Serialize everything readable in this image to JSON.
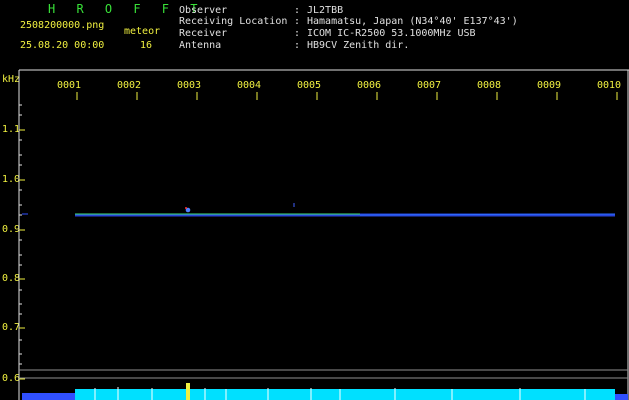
{
  "app": {
    "title": "H R O F F T"
  },
  "file": {
    "filename": "2508200000.png",
    "datetime": "25.08.20 00:00"
  },
  "meteor": {
    "label": "meteor",
    "count": "16"
  },
  "station": {
    "rows": [
      {
        "label": "Observer",
        "value": "JL2TBB"
      },
      {
        "label": "Receiving Location",
        "value": "Hamamatsu, Japan (N34°40' E137°43')"
      },
      {
        "label": "Receiver",
        "value": "ICOM IC-R2500 53.1000MHz USB"
      },
      {
        "label": "Antenna",
        "value": "HB9CV Zenith dir."
      }
    ],
    "separator": ":"
  },
  "axis": {
    "unit": "kHz",
    "y_ticks": [
      "1.1",
      "1.0",
      "0.9",
      "0.8",
      "0.7",
      "0.6"
    ],
    "x_ticks": [
      "0001",
      "0002",
      "0003",
      "0004",
      "0005",
      "0006",
      "0007",
      "0008",
      "0009",
      "0010"
    ]
  },
  "colors": {
    "background": "#000000",
    "title": "#38e038",
    "label_yellow": "#f0f040",
    "text_white": "#e0e0e0",
    "carrier_line": "#40e080",
    "signal_blue": "#3050ff",
    "noise_cyan": "#00e0ff"
  }
}
